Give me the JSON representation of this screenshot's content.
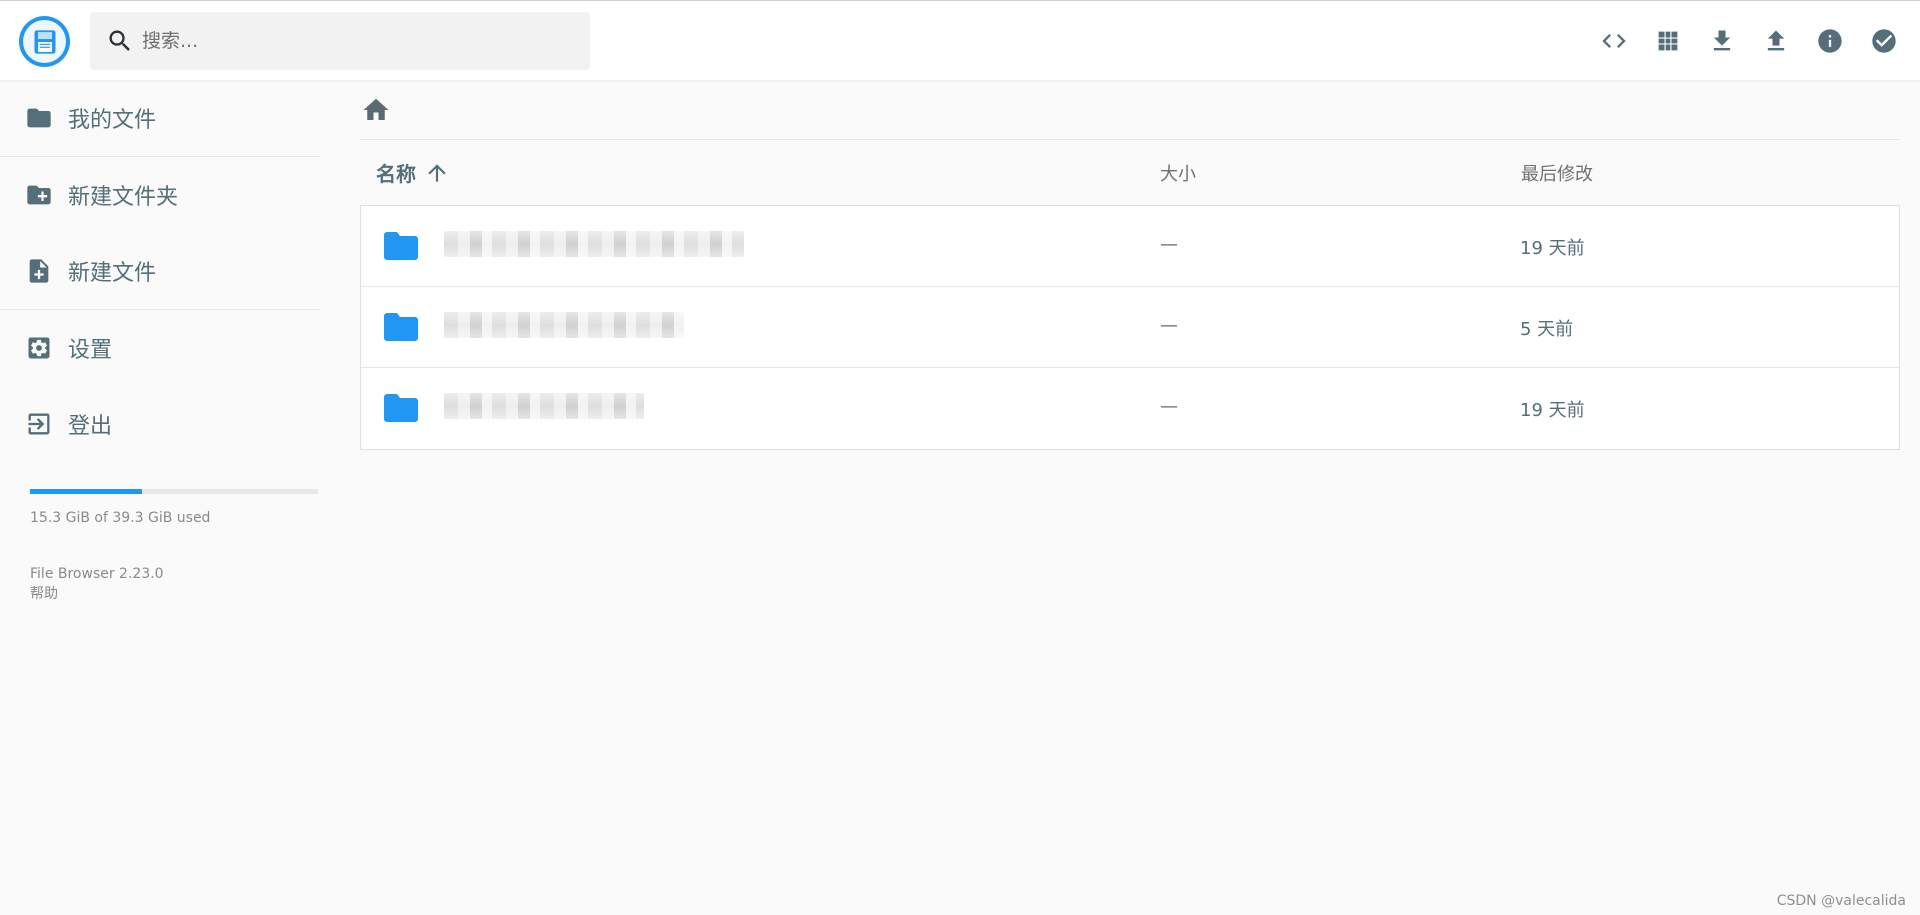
{
  "header": {
    "logo_icon": "floppy-disk-logo",
    "search_placeholder": "搜索...",
    "actions": [
      {
        "name": "code-view-icon"
      },
      {
        "name": "grid-view-icon"
      },
      {
        "name": "download-icon"
      },
      {
        "name": "upload-icon"
      },
      {
        "name": "info-icon"
      },
      {
        "name": "select-check-icon"
      }
    ]
  },
  "sidebar": {
    "items": [
      {
        "label": "我的文件",
        "icon": "folder-icon"
      },
      {
        "label": "新建文件夹",
        "icon": "new-folder-icon"
      },
      {
        "label": "新建文件",
        "icon": "new-file-icon"
      },
      {
        "label": "设置",
        "icon": "settings-icon"
      },
      {
        "label": "登出",
        "icon": "logout-icon"
      }
    ],
    "usage": {
      "text": "15.3 GiB of 39.3 GiB used",
      "fraction": 0.389
    },
    "version": "File Browser 2.23.0",
    "help": "帮助"
  },
  "breadcrumb": {
    "home_icon": "home-icon"
  },
  "table": {
    "columns": {
      "name": "名称",
      "size": "大小",
      "modified": "最后修改"
    },
    "sort": "name-ascending",
    "rows": [
      {
        "size": "—",
        "modified": "19 天前"
      },
      {
        "size": "—",
        "modified": "5 天前"
      },
      {
        "size": "—",
        "modified": "19 天前"
      }
    ]
  },
  "colors": {
    "accent": "#2196f3",
    "icon": "#546e7a",
    "background": "#fafafa"
  },
  "watermark": "CSDN @valecalida"
}
